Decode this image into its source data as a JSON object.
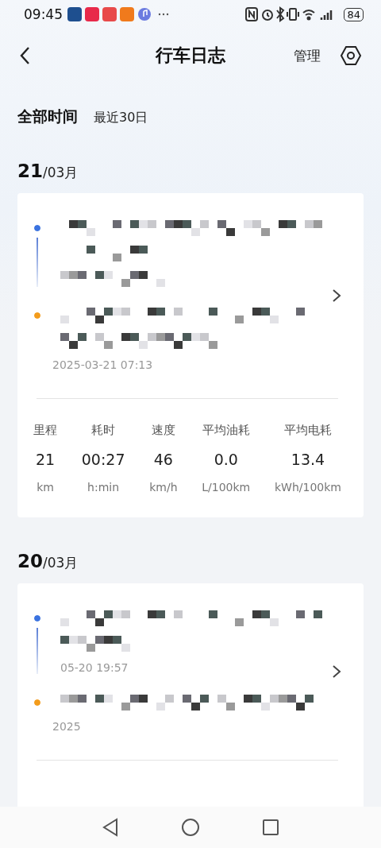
{
  "status_bar": {
    "time": "09:45",
    "battery": "84"
  },
  "header": {
    "title": "行车日志",
    "action": "管理"
  },
  "filters": [
    {
      "label": "全部时间",
      "selected": true
    },
    {
      "label": "最近30日",
      "selected": false
    }
  ],
  "trips": [
    {
      "day": "21",
      "month": "/03月",
      "end_time": "2025-03-21 07:13",
      "stats": [
        {
          "label": "里程",
          "value": "21",
          "unit": "km"
        },
        {
          "label": "耗时",
          "value": "00:27",
          "unit": "h:min"
        },
        {
          "label": "速度",
          "value": "46",
          "unit": "km/h"
        },
        {
          "label": "平均油耗",
          "value": "0.0",
          "unit": "L/100km"
        },
        {
          "label": "平均电耗",
          "value": "13.4",
          "unit": "kWh/100km"
        }
      ]
    },
    {
      "day": "20",
      "month": "/03月",
      "start_time": "05-20 19:57",
      "end_time": "2025"
    }
  ]
}
